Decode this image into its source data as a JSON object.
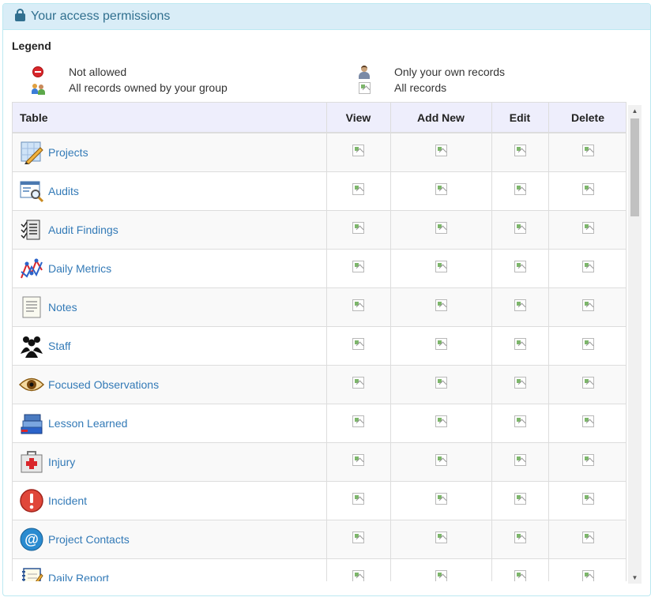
{
  "panel": {
    "title": "Your access permissions"
  },
  "legend": {
    "title": "Legend",
    "not_allowed": "Not allowed",
    "group_records": "All records owned by your group",
    "own_records": "Only your own records",
    "all_records": "All records"
  },
  "table": {
    "headers": {
      "name": "Table",
      "view": "View",
      "add": "Add New",
      "edit": "Edit",
      "delete": "Delete"
    },
    "rows": [
      {
        "name": "Projects",
        "icon": "pencil-grid-icon"
      },
      {
        "name": "Audits",
        "icon": "magnifier-window-icon"
      },
      {
        "name": "Audit Findings",
        "icon": "checklist-icon"
      },
      {
        "name": "Daily Metrics",
        "icon": "line-graph-icon"
      },
      {
        "name": "Notes",
        "icon": "note-page-icon"
      },
      {
        "name": "Staff",
        "icon": "people-group-icon"
      },
      {
        "name": "Focused Observations",
        "icon": "eye-icon"
      },
      {
        "name": "Lesson Learned",
        "icon": "books-icon"
      },
      {
        "name": "Injury",
        "icon": "first-aid-kit-icon"
      },
      {
        "name": "Incident",
        "icon": "exclamation-icon"
      },
      {
        "name": "Project Contacts",
        "icon": "at-sign-icon"
      },
      {
        "name": "Daily Report",
        "icon": "notebook-icon"
      }
    ]
  }
}
